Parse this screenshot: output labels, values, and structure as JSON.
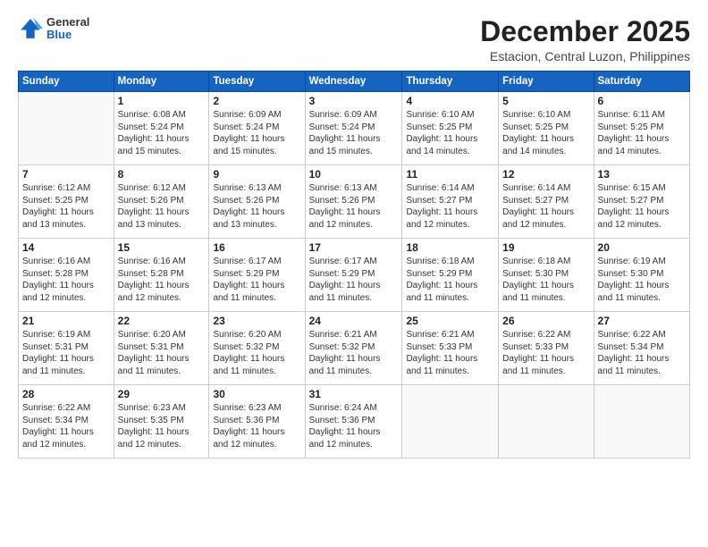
{
  "logo": {
    "general": "General",
    "blue": "Blue"
  },
  "title": "December 2025",
  "location": "Estacion, Central Luzon, Philippines",
  "days_of_week": [
    "Sunday",
    "Monday",
    "Tuesday",
    "Wednesday",
    "Thursday",
    "Friday",
    "Saturday"
  ],
  "weeks": [
    [
      {
        "day": "",
        "info": ""
      },
      {
        "day": "1",
        "info": "Sunrise: 6:08 AM\nSunset: 5:24 PM\nDaylight: 11 hours\nand 15 minutes."
      },
      {
        "day": "2",
        "info": "Sunrise: 6:09 AM\nSunset: 5:24 PM\nDaylight: 11 hours\nand 15 minutes."
      },
      {
        "day": "3",
        "info": "Sunrise: 6:09 AM\nSunset: 5:24 PM\nDaylight: 11 hours\nand 15 minutes."
      },
      {
        "day": "4",
        "info": "Sunrise: 6:10 AM\nSunset: 5:25 PM\nDaylight: 11 hours\nand 14 minutes."
      },
      {
        "day": "5",
        "info": "Sunrise: 6:10 AM\nSunset: 5:25 PM\nDaylight: 11 hours\nand 14 minutes."
      },
      {
        "day": "6",
        "info": "Sunrise: 6:11 AM\nSunset: 5:25 PM\nDaylight: 11 hours\nand 14 minutes."
      }
    ],
    [
      {
        "day": "7",
        "info": "Sunrise: 6:12 AM\nSunset: 5:25 PM\nDaylight: 11 hours\nand 13 minutes."
      },
      {
        "day": "8",
        "info": "Sunrise: 6:12 AM\nSunset: 5:26 PM\nDaylight: 11 hours\nand 13 minutes."
      },
      {
        "day": "9",
        "info": "Sunrise: 6:13 AM\nSunset: 5:26 PM\nDaylight: 11 hours\nand 13 minutes."
      },
      {
        "day": "10",
        "info": "Sunrise: 6:13 AM\nSunset: 5:26 PM\nDaylight: 11 hours\nand 12 minutes."
      },
      {
        "day": "11",
        "info": "Sunrise: 6:14 AM\nSunset: 5:27 PM\nDaylight: 11 hours\nand 12 minutes."
      },
      {
        "day": "12",
        "info": "Sunrise: 6:14 AM\nSunset: 5:27 PM\nDaylight: 11 hours\nand 12 minutes."
      },
      {
        "day": "13",
        "info": "Sunrise: 6:15 AM\nSunset: 5:27 PM\nDaylight: 11 hours\nand 12 minutes."
      }
    ],
    [
      {
        "day": "14",
        "info": "Sunrise: 6:16 AM\nSunset: 5:28 PM\nDaylight: 11 hours\nand 12 minutes."
      },
      {
        "day": "15",
        "info": "Sunrise: 6:16 AM\nSunset: 5:28 PM\nDaylight: 11 hours\nand 12 minutes."
      },
      {
        "day": "16",
        "info": "Sunrise: 6:17 AM\nSunset: 5:29 PM\nDaylight: 11 hours\nand 11 minutes."
      },
      {
        "day": "17",
        "info": "Sunrise: 6:17 AM\nSunset: 5:29 PM\nDaylight: 11 hours\nand 11 minutes."
      },
      {
        "day": "18",
        "info": "Sunrise: 6:18 AM\nSunset: 5:29 PM\nDaylight: 11 hours\nand 11 minutes."
      },
      {
        "day": "19",
        "info": "Sunrise: 6:18 AM\nSunset: 5:30 PM\nDaylight: 11 hours\nand 11 minutes."
      },
      {
        "day": "20",
        "info": "Sunrise: 6:19 AM\nSunset: 5:30 PM\nDaylight: 11 hours\nand 11 minutes."
      }
    ],
    [
      {
        "day": "21",
        "info": "Sunrise: 6:19 AM\nSunset: 5:31 PM\nDaylight: 11 hours\nand 11 minutes."
      },
      {
        "day": "22",
        "info": "Sunrise: 6:20 AM\nSunset: 5:31 PM\nDaylight: 11 hours\nand 11 minutes."
      },
      {
        "day": "23",
        "info": "Sunrise: 6:20 AM\nSunset: 5:32 PM\nDaylight: 11 hours\nand 11 minutes."
      },
      {
        "day": "24",
        "info": "Sunrise: 6:21 AM\nSunset: 5:32 PM\nDaylight: 11 hours\nand 11 minutes."
      },
      {
        "day": "25",
        "info": "Sunrise: 6:21 AM\nSunset: 5:33 PM\nDaylight: 11 hours\nand 11 minutes."
      },
      {
        "day": "26",
        "info": "Sunrise: 6:22 AM\nSunset: 5:33 PM\nDaylight: 11 hours\nand 11 minutes."
      },
      {
        "day": "27",
        "info": "Sunrise: 6:22 AM\nSunset: 5:34 PM\nDaylight: 11 hours\nand 11 minutes."
      }
    ],
    [
      {
        "day": "28",
        "info": "Sunrise: 6:22 AM\nSunset: 5:34 PM\nDaylight: 11 hours\nand 12 minutes."
      },
      {
        "day": "29",
        "info": "Sunrise: 6:23 AM\nSunset: 5:35 PM\nDaylight: 11 hours\nand 12 minutes."
      },
      {
        "day": "30",
        "info": "Sunrise: 6:23 AM\nSunset: 5:36 PM\nDaylight: 11 hours\nand 12 minutes."
      },
      {
        "day": "31",
        "info": "Sunrise: 6:24 AM\nSunset: 5:36 PM\nDaylight: 11 hours\nand 12 minutes."
      },
      {
        "day": "",
        "info": ""
      },
      {
        "day": "",
        "info": ""
      },
      {
        "day": "",
        "info": ""
      }
    ]
  ]
}
